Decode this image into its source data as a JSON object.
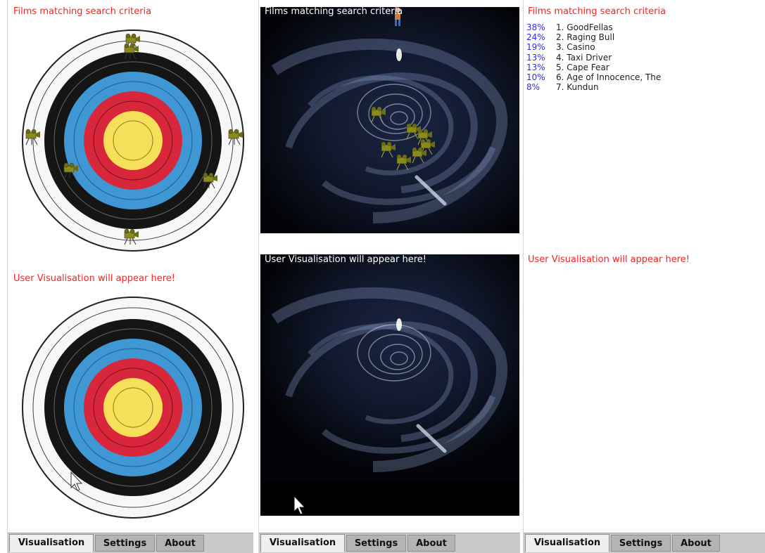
{
  "panes": [
    {
      "top_caption": "Films matching search criteria",
      "bottom_caption": "User Visualisation will appear here!",
      "tabs": [
        {
          "label": "Visualisation",
          "active": true
        },
        {
          "label": "Settings",
          "active": false
        },
        {
          "label": "About",
          "active": false
        }
      ]
    },
    {
      "top_caption": "Films matching search criteria",
      "bottom_caption": "User Visualisation will appear here!",
      "tabs": [
        {
          "label": "Visualisation",
          "active": true
        },
        {
          "label": "Settings",
          "active": false
        },
        {
          "label": "About",
          "active": false
        }
      ]
    },
    {
      "top_caption": "Films matching search criteria",
      "bottom_caption": "User Visualisation will appear here!",
      "tabs": [
        {
          "label": "Visualisation",
          "active": true
        },
        {
          "label": "Settings",
          "active": false
        },
        {
          "label": "About",
          "active": false
        }
      ]
    }
  ],
  "results": [
    {
      "pct": "38%",
      "title": "1. GoodFellas"
    },
    {
      "pct": "24%",
      "title": "2. Raging Bull"
    },
    {
      "pct": "19%",
      "title": "3. Casino"
    },
    {
      "pct": "13%",
      "title": "4. Taxi Driver"
    },
    {
      "pct": "13%",
      "title": "5. Cape Fear"
    },
    {
      "pct": "10%",
      "title": "6. Age of Innocence, The"
    },
    {
      "pct": "8%",
      "title": "7. Kundun"
    }
  ],
  "colors": {
    "caption_red": "#ff2020",
    "percent_blue": "#2b2bff",
    "target_yellow": "#f6e05a",
    "target_red": "#d8263a",
    "target_blue": "#3f97d4",
    "target_black": "#151515",
    "target_white": "#f7f7f7",
    "tabbar": "#c9c9c9"
  },
  "icons": {
    "film_marker": "movie-camera-icon",
    "user_marker": "user-figure-icon",
    "cursor": "mouse-pointer-icon"
  }
}
